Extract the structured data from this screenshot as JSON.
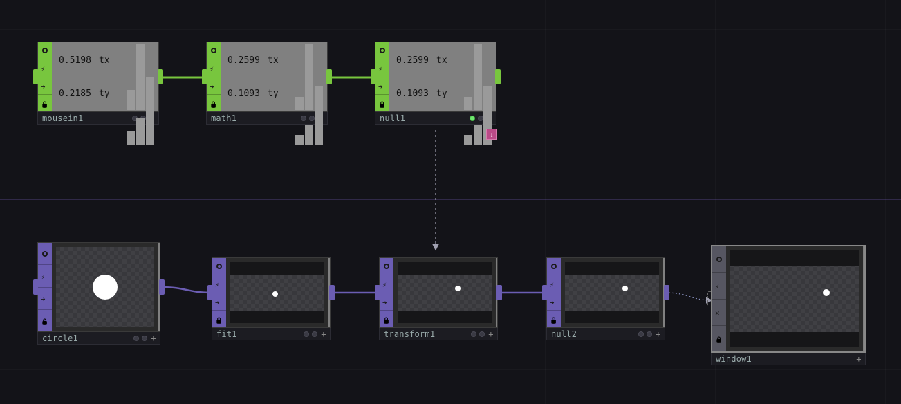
{
  "chop_nodes": {
    "mousein1": {
      "name": "mousein1",
      "tx_value": "0.5198",
      "tx_label": "tx",
      "ty_value": "0.2185",
      "ty_label": "ty"
    },
    "math1": {
      "name": "math1",
      "tx_value": "0.2599",
      "tx_label": "tx",
      "ty_value": "0.1093",
      "ty_label": "ty"
    },
    "null1": {
      "name": "null1",
      "tx_value": "0.2599",
      "tx_label": "tx",
      "ty_value": "0.1093",
      "ty_label": "ty"
    }
  },
  "top_nodes": {
    "circle1": {
      "name": "circle1"
    },
    "fit1": {
      "name": "fit1"
    },
    "transform1": {
      "name": "transform1"
    },
    "null2": {
      "name": "null2"
    },
    "window1": {
      "name": "window1"
    }
  },
  "colors": {
    "chop": "#78c63e",
    "top": "#6b5db3",
    "comp": "#565661",
    "drop": "#bb4a88"
  },
  "icons": {
    "viewer": "viewer-icon",
    "activate": "activate-icon",
    "bypass": "bypass-icon",
    "lock": "lock-icon",
    "clone": "clone-icon",
    "close": "close-icon"
  }
}
